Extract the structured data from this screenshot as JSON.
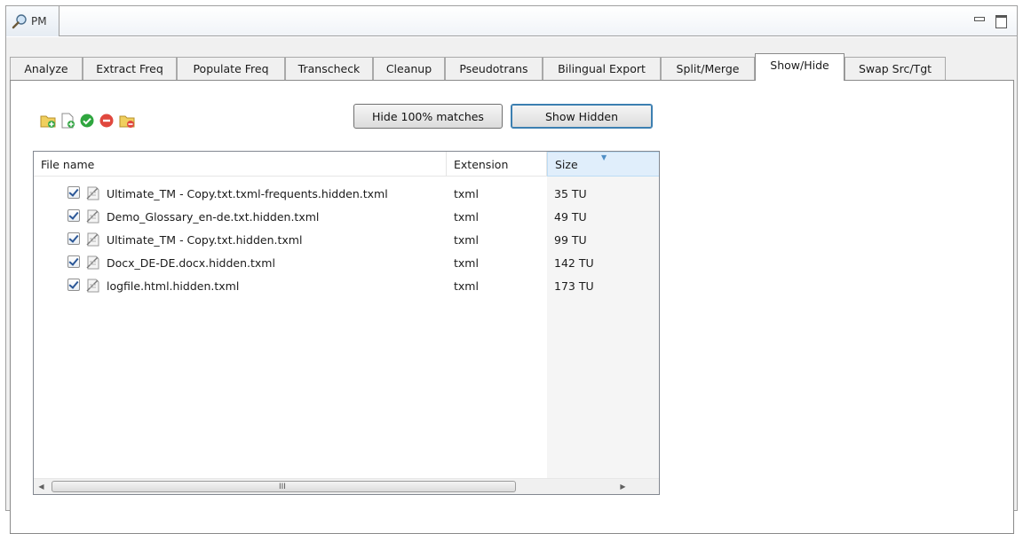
{
  "view": {
    "title": "PM"
  },
  "tabs": [
    {
      "label": "Analyze",
      "active": false
    },
    {
      "label": "Extract Freq",
      "active": false
    },
    {
      "label": "Populate Freq",
      "active": false
    },
    {
      "label": "Transcheck",
      "active": false
    },
    {
      "label": "Cleanup",
      "active": false
    },
    {
      "label": "Pseudotrans",
      "active": false
    },
    {
      "label": "Bilingual Export",
      "active": false
    },
    {
      "label": "Split/Merge",
      "active": false
    },
    {
      "label": "Show/Hide",
      "active": true
    },
    {
      "label": "Swap Src/Tgt",
      "active": false
    }
  ],
  "toolbar": {
    "icons": [
      "add-folder-icon",
      "add-file-icon",
      "check-icon",
      "remove-icon",
      "remove-folder-icon"
    ],
    "hide_button": "Hide 100% matches",
    "show_button": "Show Hidden"
  },
  "table": {
    "columns": [
      "File name",
      "Extension",
      "Size"
    ],
    "sorted_column": "Size",
    "rows": [
      {
        "checked": true,
        "name": "Ultimate_TM - Copy.txt.txml-frequents.hidden.txml",
        "extension": "txml",
        "size": "35 TU"
      },
      {
        "checked": true,
        "name": "Demo_Glossary_en-de.txt.hidden.txml",
        "extension": "txml",
        "size": "49 TU"
      },
      {
        "checked": true,
        "name": "Ultimate_TM - Copy.txt.hidden.txml",
        "extension": "txml",
        "size": "99 TU"
      },
      {
        "checked": true,
        "name": "Docx_DE-DE.docx.hidden.txml",
        "extension": "txml",
        "size": "142 TU"
      },
      {
        "checked": true,
        "name": "logfile.html.hidden.txml",
        "extension": "txml",
        "size": "173 TU"
      }
    ]
  },
  "scrollbar": {
    "grip": "III"
  },
  "colors": {
    "check": "#2a9d3a",
    "remove": "#e0483e",
    "folder": "#e8c14a",
    "accent": "#3c7fb1"
  }
}
